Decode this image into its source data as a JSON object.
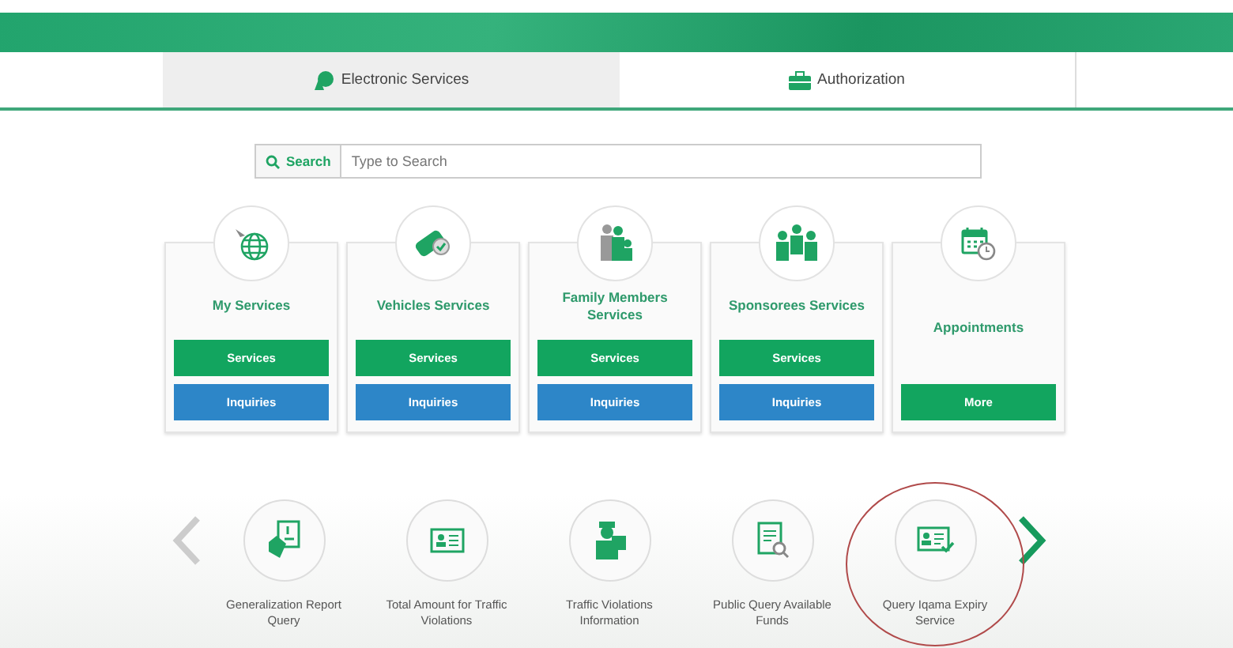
{
  "tabs": [
    {
      "label": "Electronic Services",
      "selected": true
    },
    {
      "label": "Authorization",
      "selected": false
    }
  ],
  "search": {
    "button": "Search",
    "placeholder": "Type to Search"
  },
  "cards": [
    {
      "title": "My Services",
      "buttons": [
        {
          "label": "Services",
          "kind": "green"
        },
        {
          "label": "Inquiries",
          "kind": "blue"
        }
      ]
    },
    {
      "title": "Vehicles Services",
      "buttons": [
        {
          "label": "Services",
          "kind": "green"
        },
        {
          "label": "Inquiries",
          "kind": "blue"
        }
      ]
    },
    {
      "title": "Family Members Services",
      "buttons": [
        {
          "label": "Services",
          "kind": "green"
        },
        {
          "label": "Inquiries",
          "kind": "blue"
        }
      ]
    },
    {
      "title": "Sponsorees Services",
      "buttons": [
        {
          "label": "Services",
          "kind": "green"
        },
        {
          "label": "Inquiries",
          "kind": "blue"
        }
      ]
    },
    {
      "title": "Appointments",
      "buttons": [
        {
          "label": "More",
          "kind": "green"
        }
      ]
    }
  ],
  "carousel": [
    {
      "label": "Generalization Report Query",
      "highlighted": false
    },
    {
      "label": "Total Amount for Traffic Violations",
      "highlighted": false
    },
    {
      "label": "Traffic Violations Information",
      "highlighted": false
    },
    {
      "label": "Public Query Available Funds",
      "highlighted": false
    },
    {
      "label": "Query Iqama Expiry Service",
      "highlighted": true
    }
  ]
}
